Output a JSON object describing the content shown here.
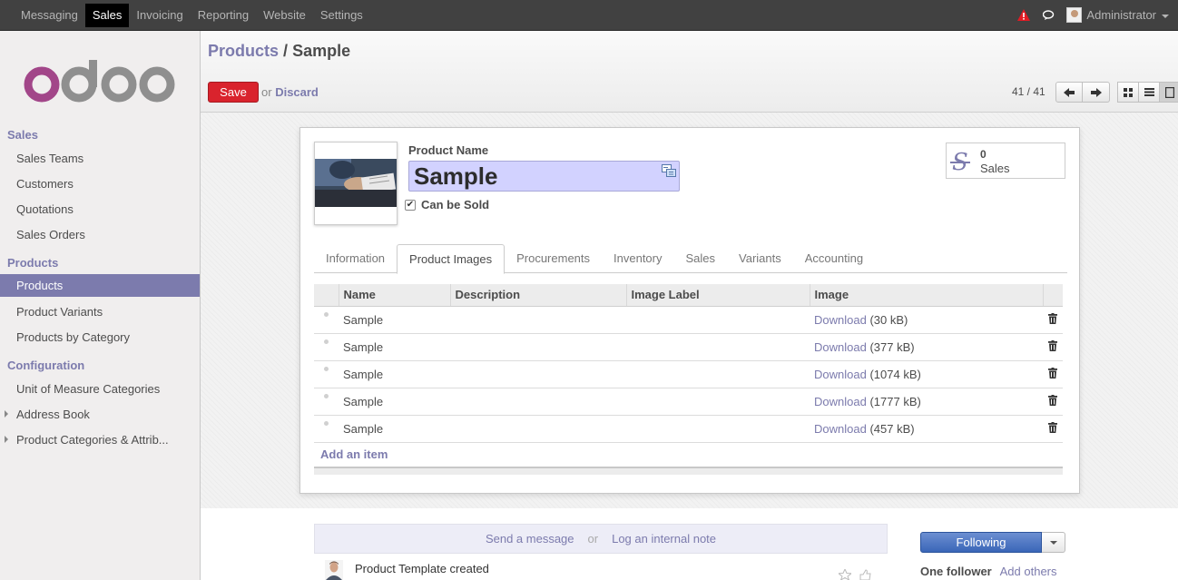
{
  "topbar": {
    "menu": [
      "Messaging",
      "Sales",
      "Invoicing",
      "Reporting",
      "Website",
      "Settings"
    ],
    "active_index": 1,
    "user": "Administrator"
  },
  "sidebar": {
    "sections": [
      {
        "title": "Sales",
        "items": [
          "Sales Teams",
          "Customers",
          "Quotations",
          "Sales Orders"
        ]
      },
      {
        "title": "Products",
        "items": [
          "Products",
          "Product Variants",
          "Products by Category"
        ]
      },
      {
        "title": "Configuration",
        "items": [
          "Unit of Measure Categories",
          "Address Book",
          "Product Categories & Attrib..."
        ]
      }
    ],
    "active_item": "Products"
  },
  "control_panel": {
    "breadcrumb_link": "Products",
    "breadcrumb_sep": "/",
    "breadcrumb_current": "Sample",
    "save_label": "Save",
    "or_text": "or",
    "discard_label": "Discard",
    "pager": "41 / 41"
  },
  "form": {
    "name_label": "Product Name",
    "name_value": "Sample",
    "can_be_sold_label": "Can be Sold",
    "can_be_sold": true,
    "stat": {
      "value": "0",
      "label": "Sales"
    },
    "tabs": [
      "Information",
      "Product Images",
      "Procurements",
      "Inventory",
      "Sales",
      "Variants",
      "Accounting"
    ],
    "active_tab": "Product Images",
    "table": {
      "headers": [
        "Name",
        "Description",
        "Image Label",
        "Image"
      ],
      "rows": [
        {
          "name": "Sample",
          "description": "",
          "label": "",
          "link": "Download",
          "size": "(30 kB)"
        },
        {
          "name": "Sample",
          "description": "",
          "label": "",
          "link": "Download",
          "size": "(377 kB)"
        },
        {
          "name": "Sample",
          "description": "",
          "label": "",
          "link": "Download",
          "size": "(1074 kB)"
        },
        {
          "name": "Sample",
          "description": "",
          "label": "",
          "link": "Download",
          "size": "(1777 kB)"
        },
        {
          "name": "Sample",
          "description": "",
          "label": "",
          "link": "Download",
          "size": "(457 kB)"
        }
      ],
      "add_item": "Add an item"
    }
  },
  "chatter": {
    "send_message": "Send a message",
    "or": "or",
    "log_note": "Log an internal note",
    "following_label": "Following",
    "follower_count": "One follower",
    "add_others": "Add others",
    "message": "Product Template created"
  },
  "colors": {
    "accent": "#7c7bad",
    "save": "#d9232d",
    "following": "#3a66b8"
  }
}
